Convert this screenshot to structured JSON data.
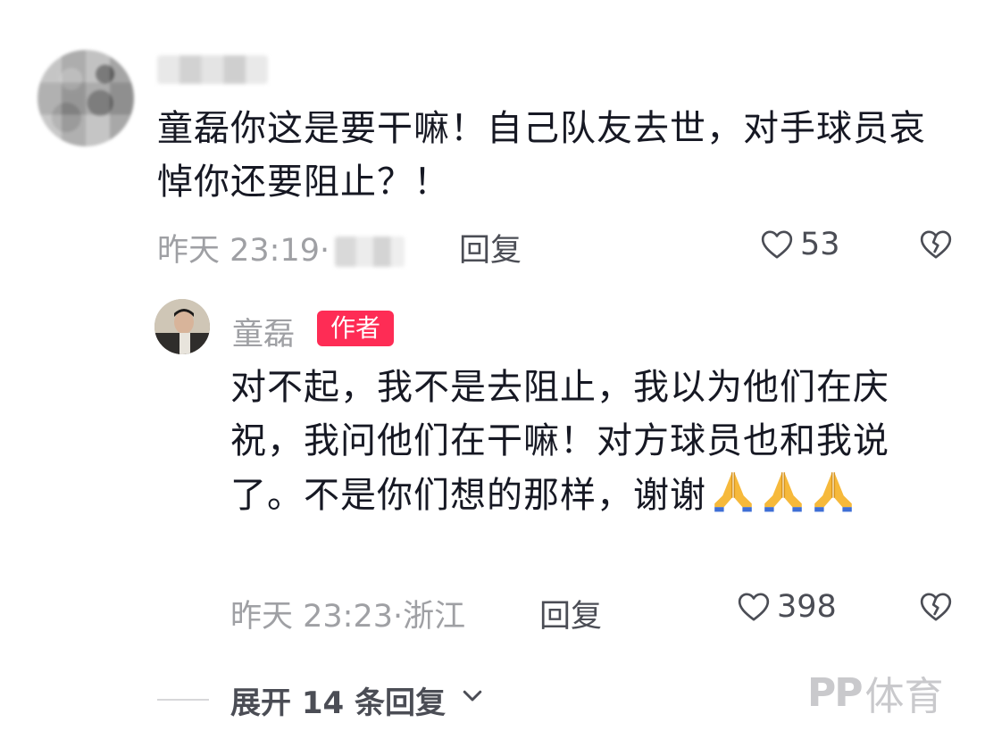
{
  "comment": {
    "username": "",
    "text": "童磊你这是要干嘛！自己队友去世，对手球员哀悼你还要阻止？！",
    "time": "昨天 23:19·",
    "location": "",
    "reply_label": "回复",
    "likes": "53"
  },
  "reply": {
    "author_name": "童磊",
    "author_badge": "作者",
    "text": "对不起，我不是去阻止，我以为他们在庆祝，我问他们在干嘛！对方球员也和我说了。不是你们想的那样，谢谢",
    "emojis": [
      "folded-hands",
      "folded-hands",
      "folded-hands"
    ],
    "time": "昨天 23:23·浙江",
    "reply_label": "回复",
    "likes": "398"
  },
  "expand": {
    "label": "展开 14 条回复"
  },
  "watermark": {
    "logo": "PP",
    "text": "体育"
  },
  "colors": {
    "badge": "#fe2c55",
    "meta_gray": "#9fa0a4",
    "text_dark": "#161823"
  }
}
